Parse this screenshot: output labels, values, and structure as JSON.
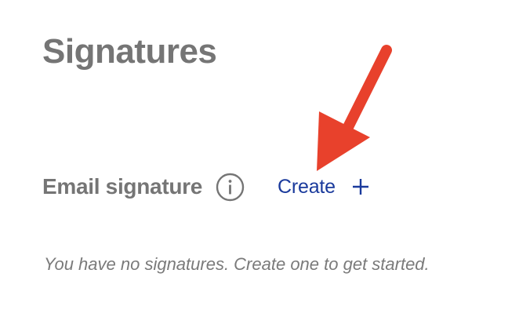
{
  "page": {
    "title": "Signatures"
  },
  "email_signature": {
    "label": "Email signature",
    "info_icon": "info-circle-icon",
    "create_label": "Create",
    "create_icon": "plus-icon",
    "empty_message": "You have no signatures. Create one to get started."
  },
  "annotation": {
    "arrow_icon": "red-arrow",
    "color": "#e8412c"
  },
  "colors": {
    "heading": "#757575",
    "link": "#1a3a9c",
    "muted": "#7a7a7a"
  }
}
